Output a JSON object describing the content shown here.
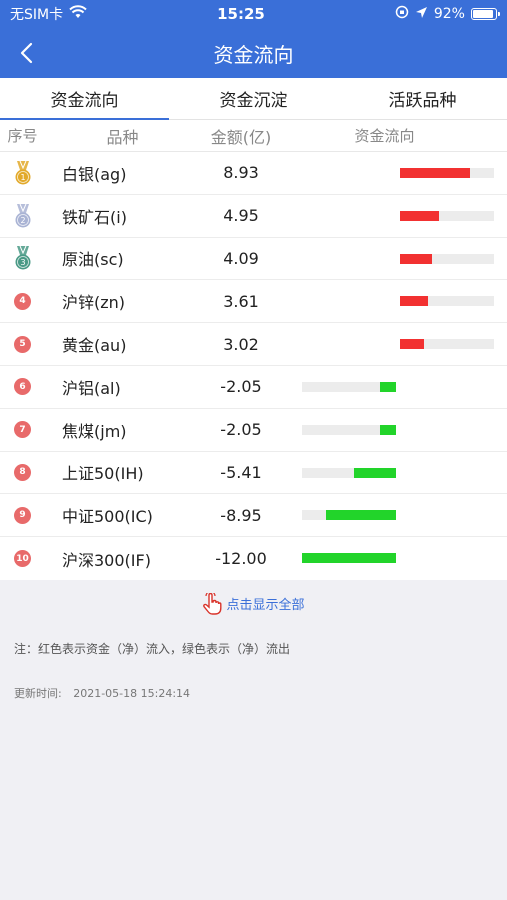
{
  "status_bar": {
    "carrier": "无SIM卡",
    "time": "15:25",
    "battery": "92%"
  },
  "header": {
    "title": "资金流向"
  },
  "tabs": [
    {
      "label": "资金流向",
      "active": true
    },
    {
      "label": "资金沉淀",
      "active": false
    },
    {
      "label": "活跃品种",
      "active": false
    }
  ],
  "table": {
    "columns": {
      "rank": "序号",
      "name": "品种",
      "amount": "金额(亿)",
      "flow": "资金流向"
    },
    "rows": [
      {
        "rank": "1",
        "name": "白银(ag)",
        "amount": "8.93",
        "value": 8.93
      },
      {
        "rank": "2",
        "name": "铁矿石(i)",
        "amount": "4.95",
        "value": 4.95
      },
      {
        "rank": "3",
        "name": "原油(sc)",
        "amount": "4.09",
        "value": 4.09
      },
      {
        "rank": "4",
        "name": "沪锌(zn)",
        "amount": "3.61",
        "value": 3.61
      },
      {
        "rank": "5",
        "name": "黄金(au)",
        "amount": "3.02",
        "value": 3.02
      },
      {
        "rank": "6",
        "name": "沪铝(al)",
        "amount": "-2.05",
        "value": -2.05
      },
      {
        "rank": "7",
        "name": "焦煤(jm)",
        "amount": "-2.05",
        "value": -2.05
      },
      {
        "rank": "8",
        "name": "上证50(IH)",
        "amount": "-5.41",
        "value": -5.41
      },
      {
        "rank": "9",
        "name": "中证500(IC)",
        "amount": "-8.95",
        "value": -8.95
      },
      {
        "rank": "10",
        "name": "沪深300(IF)",
        "amount": "-12.00",
        "value": -12.0
      }
    ]
  },
  "show_all": "点击显示全部",
  "note": "注：红色表示资金（净）流入，绿色表示（净）流出",
  "update_label": "更新时间:",
  "update_time": "2021-05-18 15:24:14",
  "colors": {
    "accent": "#3a6fd8",
    "inflow": "#f23131",
    "outflow": "#22d42a",
    "gold": "#e2a92a",
    "silver": "#a9b3d4",
    "bronze": "#4a9a86"
  }
}
